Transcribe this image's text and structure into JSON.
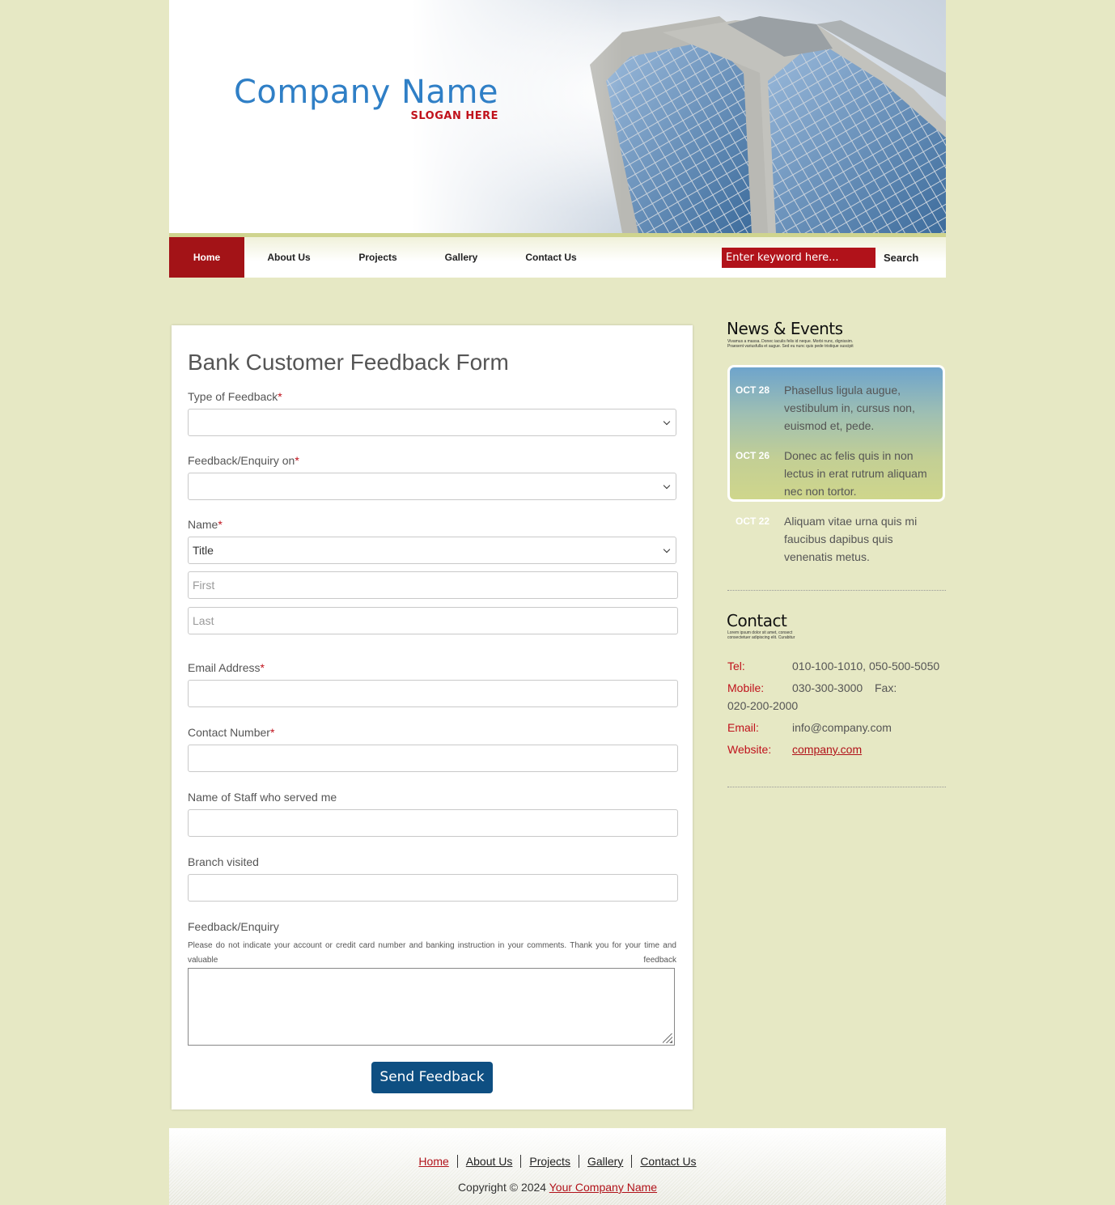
{
  "header": {
    "company_name": "Company Name",
    "slogan": "SLOGAN HERE"
  },
  "nav": {
    "items": [
      {
        "label": "Home",
        "active": true
      },
      {
        "label": "About Us"
      },
      {
        "label": "Projects"
      },
      {
        "label": "Gallery"
      },
      {
        "label": "Contact Us"
      }
    ],
    "search_placeholder": "Enter keyword here...",
    "search_label": "Search"
  },
  "form": {
    "title": "Bank Customer Feedback Form",
    "required_mark": "*",
    "type_label": "Type of Feedback",
    "type_value": "",
    "enquiry_on_label": "Feedback/Enquiry on",
    "enquiry_on_value": "",
    "name_label": "Name",
    "title_value": "Title",
    "first_placeholder": "First",
    "last_placeholder": "Last",
    "email_label": "Email Address",
    "contact_label": "Contact Number",
    "staff_label": "Name of Staff who served me",
    "branch_label": "Branch visited",
    "feedback_label": "Feedback/Enquiry",
    "feedback_note": "Please do not indicate your account or credit card number and banking instruction in your comments. Thank you for your time and valuable feedback",
    "submit_label": "Send Feedback"
  },
  "news": {
    "title": "News & Events",
    "subtitle": "Vivamus a massa. Donec iaculis felis id neque. Morbi nunc, dignissim. Praesent variusfulla et augue. Sed eu nunc quis pede tristique suscipit",
    "items": [
      {
        "date": "OCT 28",
        "text": "Phasellus ligula augue, vestibulum in, cursus non, euismod et, pede."
      },
      {
        "date": "OCT 26",
        "text": "Donec ac felis quis in non lectus in erat rutrum aliquam nec non tortor."
      },
      {
        "date": "OCT 22",
        "text": "Aliquam vitae urna quis mi faucibus dapibus quis venenatis metus."
      }
    ]
  },
  "contact": {
    "title": "Contact",
    "subtitle": "Lorem ipsum dolor sit amet, consect consectetuer adipiscing elit. Curabitur",
    "tel_label": "Tel:",
    "tel_value": "010-100-1010, 050-500-5050",
    "mobile_label": "Mobile:",
    "mobile_value": "030-300-3000",
    "fax_label": "Fax:",
    "fax_value": "020-200-2000",
    "email_label": "Email:",
    "email_value": "info@company.com",
    "website_label": "Website:",
    "website_value": "company.com"
  },
  "footer": {
    "links": [
      "Home",
      "About Us",
      "Projects",
      "Gallery",
      "Contact Us"
    ],
    "copyright": "Copyright © 2024 ",
    "company_link": "Your Company Name"
  },
  "colors": {
    "background": "#e6e8c4",
    "accent_red": "#a31317",
    "logo_blue": "#2f7fc6",
    "button_blue": "#0e4f82"
  }
}
